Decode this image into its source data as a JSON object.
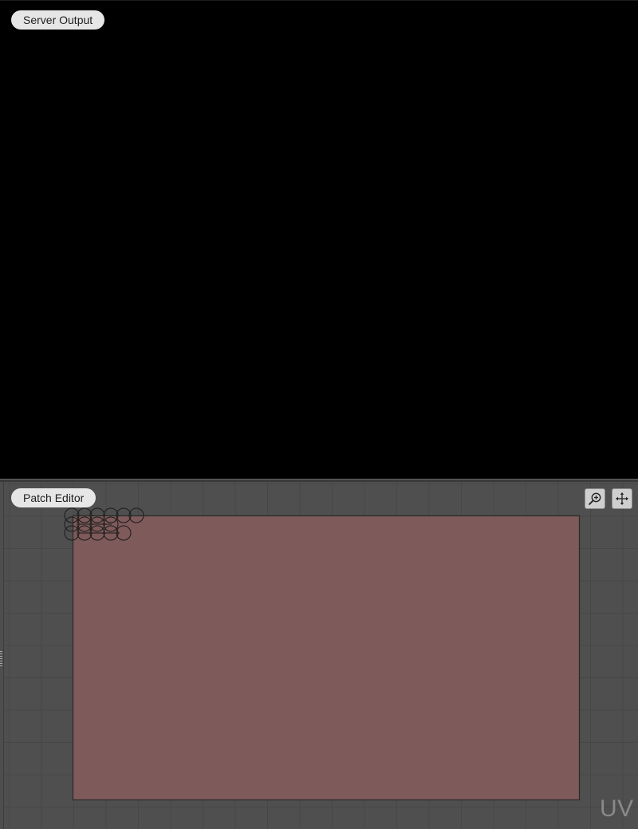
{
  "server_output": {
    "label": "Server Output"
  },
  "patch_editor": {
    "label": "Patch Editor",
    "toolbar": {
      "zoom_icon": "zoom-in-icon",
      "pan_icon": "pan-move-icon"
    },
    "watermark": "UV",
    "patch_color": "#7e5a5a",
    "background_color": "#4e4e4e",
    "grid_color": "#464646"
  }
}
